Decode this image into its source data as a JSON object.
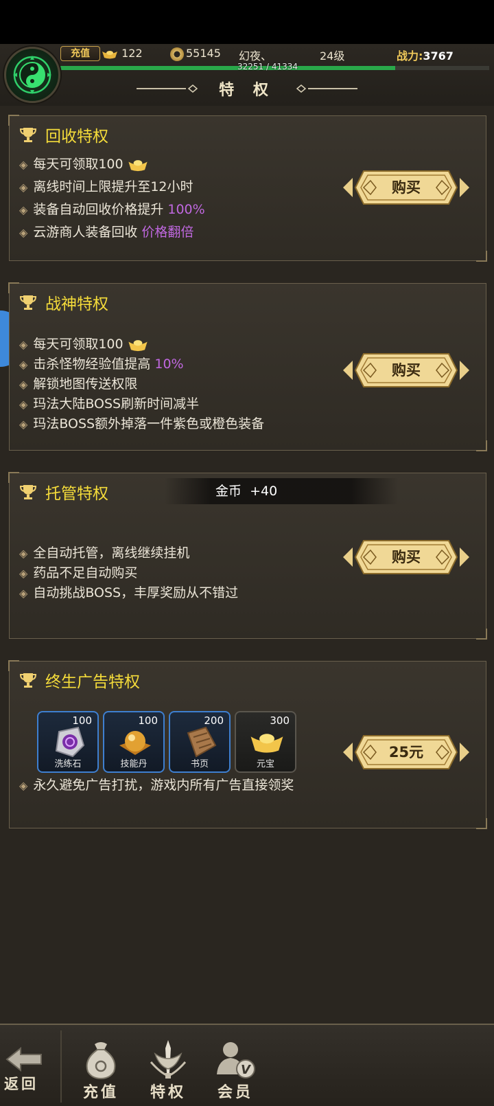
{
  "header": {
    "recharge_tag": "充值",
    "ingot_count": "122",
    "coin_count": "55145",
    "player_name": "幻夜、",
    "level": "24级",
    "power_label": "战力:",
    "power_value": "3767",
    "exp_text": "32251 / 41334",
    "exp_fraction": 0.78,
    "page_title": "特 权"
  },
  "panels": [
    {
      "title": "回收特权",
      "perks": [
        {
          "text": "每天可领取100",
          "icon": "ingot-icon"
        },
        {
          "text": "离线时间上限提升至12小时"
        },
        {
          "text": "装备自动回收价格提升 ",
          "highlight": "100%"
        },
        {
          "text": "云游商人装备回收 ",
          "highlight": "价格翻倍"
        }
      ],
      "button": "购买"
    },
    {
      "title": "战神特权",
      "perks": [
        {
          "text": "每天可领取100",
          "icon": "ingot-icon"
        },
        {
          "text": "击杀怪物经验值提高 ",
          "highlight": "10%"
        },
        {
          "text": "解锁地图传送权限"
        },
        {
          "text": "玛法大陆BOSS刷新时间减半"
        },
        {
          "text": "玛法BOSS额外掉落一件紫色或橙色装备"
        }
      ],
      "button": "购买"
    },
    {
      "title": "托管特权",
      "perks": [
        {
          "text": "全自动托管，离线继续挂机"
        },
        {
          "text": "药品不足自动购买"
        },
        {
          "text": "自动挑战BOSS，丰厚奖励从不错过"
        }
      ],
      "button": "购买"
    },
    {
      "title": "终生广告特权",
      "rewards": [
        {
          "name": "洗练石",
          "count": "100",
          "icon": "purple-stone-icon"
        },
        {
          "name": "技能丹",
          "count": "100",
          "icon": "skill-pill-icon"
        },
        {
          "name": "书页",
          "count": "200",
          "icon": "book-page-icon"
        },
        {
          "name": "元宝",
          "count": "300",
          "icon": "ingot-icon"
        }
      ],
      "perks": [
        {
          "text": "永久避免广告打扰，游戏内所有广告直接领奖"
        }
      ],
      "button": "25元"
    }
  ],
  "toast": {
    "label": "金币",
    "value": "+40"
  },
  "bottom_nav": {
    "back": "返回",
    "recharge": "充值",
    "privilege": "特权",
    "member": "会员"
  },
  "colors": {
    "accent_yellow": "#f5dc3a",
    "highlight_purple": "#c068e0",
    "button_gold": "#e9cf8a",
    "exp_green": "#29a84a"
  }
}
